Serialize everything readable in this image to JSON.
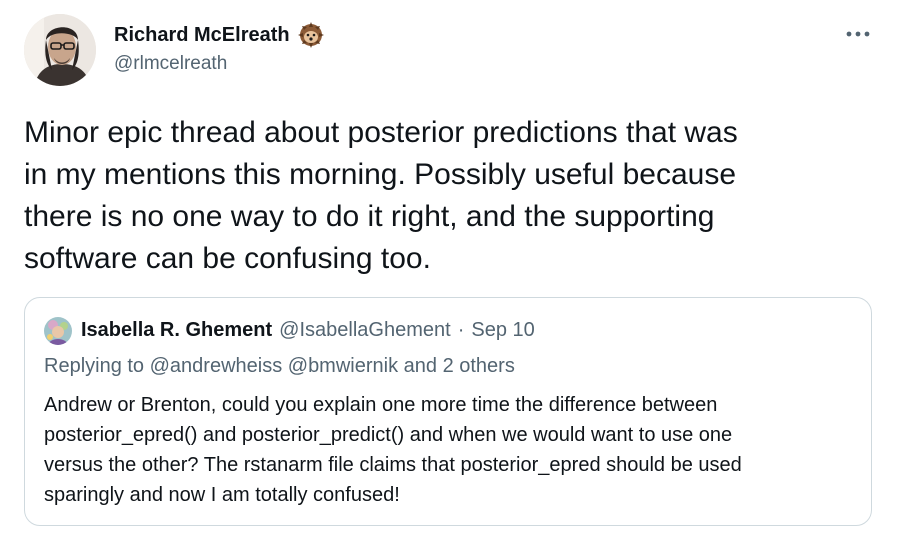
{
  "author": {
    "name": "Richard McElreath",
    "handle": "@rlmcelreath",
    "avatar_icon": "profile-photo",
    "emoji_icon": "hedgehog-emoji"
  },
  "menu": {
    "icon": "more-horizontal-icon"
  },
  "tweet": {
    "text": "Minor epic thread about posterior predictions that was\nin my mentions this morning. Possibly useful because\nthere is no one way to do it right, and the supporting\nsoftware can be confusing too."
  },
  "quoted": {
    "name": "Isabella R. Ghement",
    "handle": "@IsabellaGhement",
    "separator": "·",
    "date": "Sep 10",
    "reply": "Replying to @andrewheiss @bmwiernik and 2 others",
    "text": "Andrew or Brenton, could you explain one more time the difference between\nposterior_epred() and posterior_predict() and when we would want to use one\nversus the other? The rstanarm file claims that posterior_epred should be used\nsparingly and now I am totally confused!"
  },
  "colors": {
    "text": "#0f1419",
    "secondary": "#536471",
    "border": "#cfd9de"
  }
}
